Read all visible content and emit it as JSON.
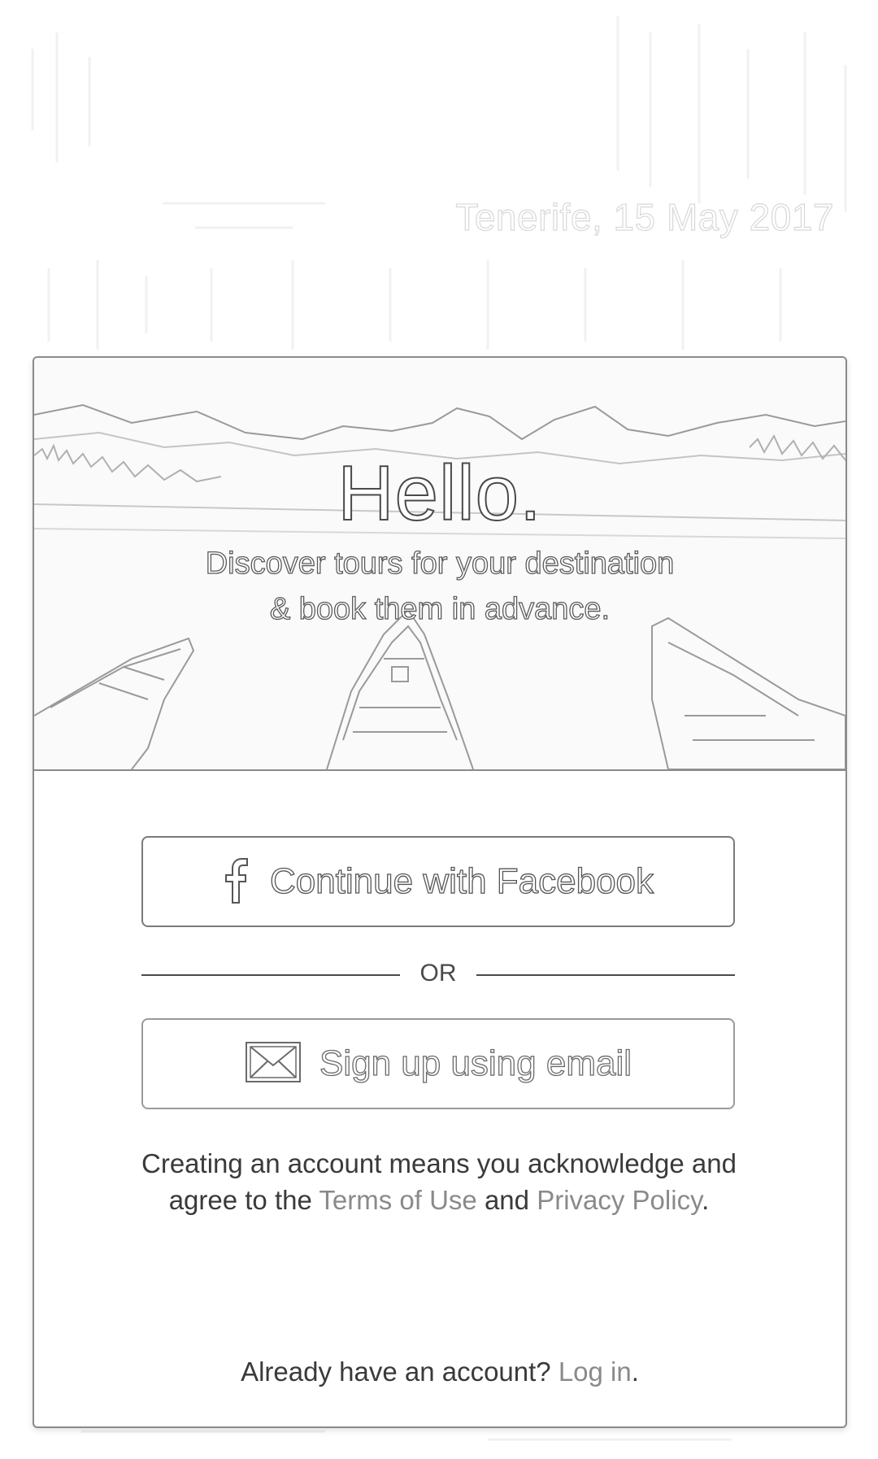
{
  "header": {
    "location_date": "Tenerife, 15 May 2017"
  },
  "hero": {
    "title": "Hello.",
    "subtitle_line1": "Discover tours for your destination",
    "subtitle_line2": "& book them in advance."
  },
  "auth": {
    "facebook_label": "Continue with Facebook",
    "facebook_icon": "facebook-f-icon",
    "divider_label": "OR",
    "email_label": "Sign up using email",
    "email_icon": "envelope-icon"
  },
  "legal": {
    "prefix": "Creating an account means you acknowledge and agree to the ",
    "terms_link": "Terms of Use",
    "middle": " and ",
    "privacy_link": "Privacy Policy",
    "suffix": "."
  },
  "login": {
    "prompt": "Already have an account? ",
    "link": "Log in",
    "suffix": "."
  }
}
